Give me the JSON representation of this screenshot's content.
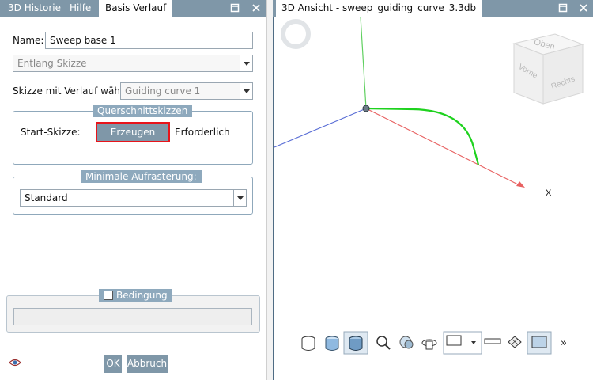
{
  "left_panel": {
    "tabs": [
      {
        "label": "3D Historie"
      },
      {
        "label": "Hilfe"
      },
      {
        "label": "Basis Verlauf"
      }
    ],
    "name_label": "Name:",
    "name_value": "Sweep base 1",
    "mode_select": "Entlang Skizze",
    "sketch_label": "Skizze mit Verlauf wählen:",
    "sketch_select": "Guiding curve 1",
    "cross_section_group": "Querschnittskizzen",
    "start_sketch_label": "Start-Skizze:",
    "create_button": "Erzeugen",
    "required_text": "Erforderlich",
    "raster_group": "Minimale Aufrasterung:",
    "raster_select": "Standard",
    "condition_label": "Bedingung",
    "condition_checked": false,
    "ok_button": "OK",
    "cancel_button": "Abbruch"
  },
  "right_panel": {
    "title": "3D Ansicht - sweep_guiding_curve_3.3db",
    "view_cube": {
      "top": "Oben",
      "front": "Vorne",
      "right": "Rechts"
    },
    "axis_x_label": "X",
    "toolbar_icons": [
      "cylinder-outline-icon",
      "cylinder-shaded-icon",
      "cylinder-solid-icon",
      "zoom-icon",
      "sphere-view-icon",
      "rotate-icon",
      "display-mode-dropdown-icon",
      "ruler-icon",
      "mesh-cube-icon",
      "section-view-icon",
      "more-icon"
    ],
    "overflow": "»"
  },
  "colors": {
    "tab_bar": "#7f97a8",
    "highlight_border": "#e8141a",
    "axis_x": "#e86060",
    "axis_y": "#60d060",
    "axis_z": "#5b6fd6",
    "guide_curve": "#1fd21f"
  }
}
